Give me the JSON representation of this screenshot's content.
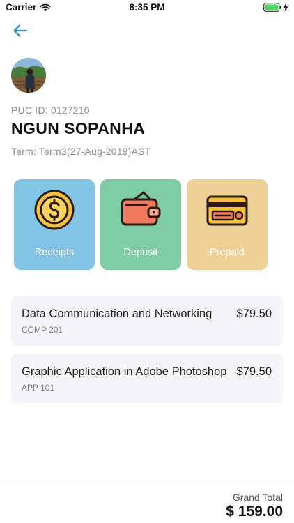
{
  "status_bar": {
    "carrier": "Carrier",
    "time": "8:35 PM",
    "icons": [
      "wifi-icon",
      "battery-icon",
      "charging-icon"
    ],
    "battery_color": "#4cd964"
  },
  "nav": {
    "back_icon": "arrow-left-icon",
    "accent_color": "#2f8fd8"
  },
  "profile": {
    "puc_id": "PUC ID: 0127210",
    "name": "NGUN SOPANHA",
    "term": "Term: Term3(27-Aug-2019)AST"
  },
  "tiles": [
    {
      "label": "Receipts",
      "icon": "coin-icon",
      "color": "#83c3e3"
    },
    {
      "label": "Deposit",
      "icon": "wallet-icon",
      "color": "#7fcca7"
    },
    {
      "label": "Prepaid",
      "icon": "credit-card-icon",
      "color": "#efd198"
    }
  ],
  "courses": [
    {
      "title": "Data Communication and Networking",
      "code": "COMP 201",
      "price": "$79.50"
    },
    {
      "title": "Graphic Application in Adobe Photoshop",
      "code": "APP 101",
      "price": "$79.50"
    }
  ],
  "footer": {
    "label": "Grand Total",
    "amount": "$ 159.00"
  }
}
